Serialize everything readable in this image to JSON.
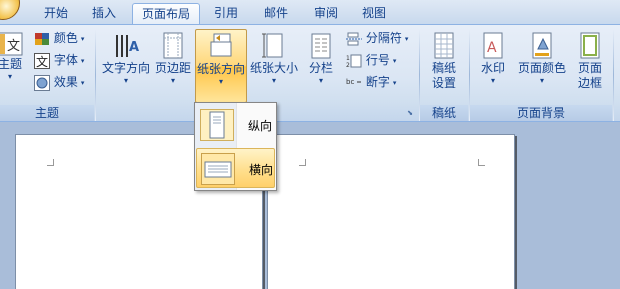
{
  "tabs": [
    "开始",
    "插入",
    "页面布局",
    "引用",
    "邮件",
    "审阅",
    "视图"
  ],
  "active_tab": "页面布局",
  "groups": {
    "theme": {
      "label": "主题",
      "theme_button": "主题",
      "colors": "颜色",
      "fonts": "字体",
      "effects": "效果"
    },
    "page_setup": {
      "text_direction": "文字方向",
      "margins": "页边距",
      "orientation": "纸张方向",
      "size": "纸张大小",
      "columns": "分栏",
      "breaks": "分隔符",
      "line_numbers": "行号",
      "hyphenation": "断字"
    },
    "draft": {
      "label": "稿纸",
      "button_line1": "稿纸",
      "button_line2": "设置"
    },
    "page_background": {
      "label": "页面背景",
      "watermark": "水印",
      "page_color": "页面颜色",
      "borders_line1": "页面",
      "borders_line2": "边框"
    }
  },
  "orientation_menu": {
    "items": [
      {
        "label": "纵向",
        "selected": false
      },
      {
        "label": "横向",
        "selected": true
      }
    ]
  },
  "colors": {
    "ribbon_text": "#15428b",
    "highlight": "#ffd77a",
    "doc_background": "#a9bdd9"
  }
}
